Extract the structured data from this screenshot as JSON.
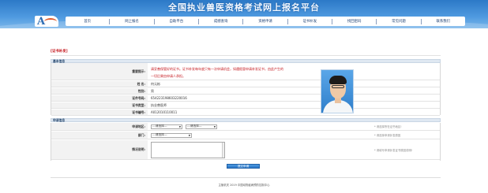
{
  "header": {
    "site_title": "全国执业兽医资格考试网上报名平台",
    "logo_letter": "A"
  },
  "nav": {
    "items": [
      "首页",
      "网上报名",
      "自助平台",
      "成绩查询",
      "资格申请",
      "证书补发",
      "找回密码",
      "常见问题",
      "联系我们"
    ]
  },
  "page_title": "[证书补发]",
  "basic_section": {
    "heading": "基本信息",
    "warning_label": "重要提示:",
    "warning_text_line1": "请妥善保管好的证书。证书补发每年度只有一次申请机会，如遇假冒申请补发证书，由此产生的",
    "warning_text_line2": "一切后果由申请人承担。",
    "name_label": "姓 名:",
    "name_value": "何元彬",
    "gender_label": "性别:",
    "gender_value": "男",
    "id_label": "证件号码:",
    "id_value": "654223198603220016",
    "cert_type_label": "证书类型:",
    "cert_type_value": "执业兽医师",
    "cert_no_label": "证书编号:",
    "cert_no_value": "A012010110011"
  },
  "apply_section": {
    "heading": "申请信息",
    "region_label": "申请地区:",
    "province_select": "---请选择---",
    "city_select": "---请选择---",
    "region_hint": "* 请选择所在证书地区!",
    "dept_label": "部门:",
    "dept_select": "---请选择---",
    "dept_hint": "* 请选择申请补发原因",
    "reason_label": "情况说明:",
    "reason_value": "",
    "reason_hint": "* 请填写申请补发证书原因说明!"
  },
  "submit_label": "提交申请",
  "footer": {
    "text": "主管机关 2019 中国动物疫病预防控制中心"
  }
}
